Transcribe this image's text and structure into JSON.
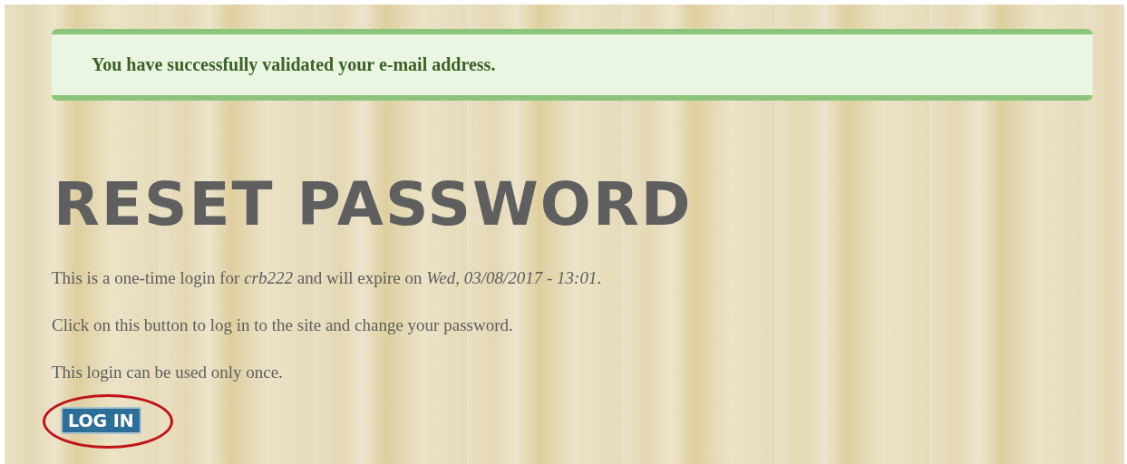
{
  "message": {
    "text": "You have successfully validated your e-mail address."
  },
  "title": "RESET PASSWORD",
  "paragraphs": [
    "This is a one-time login for *crb222* and will expire on *Wed, 03/08/2017 - 13:01*.",
    "Click on this button to log in to the site and change your password.",
    "This login can be used only once."
  ],
  "button": {
    "label": "LOG IN",
    "highlighted": true
  }
}
